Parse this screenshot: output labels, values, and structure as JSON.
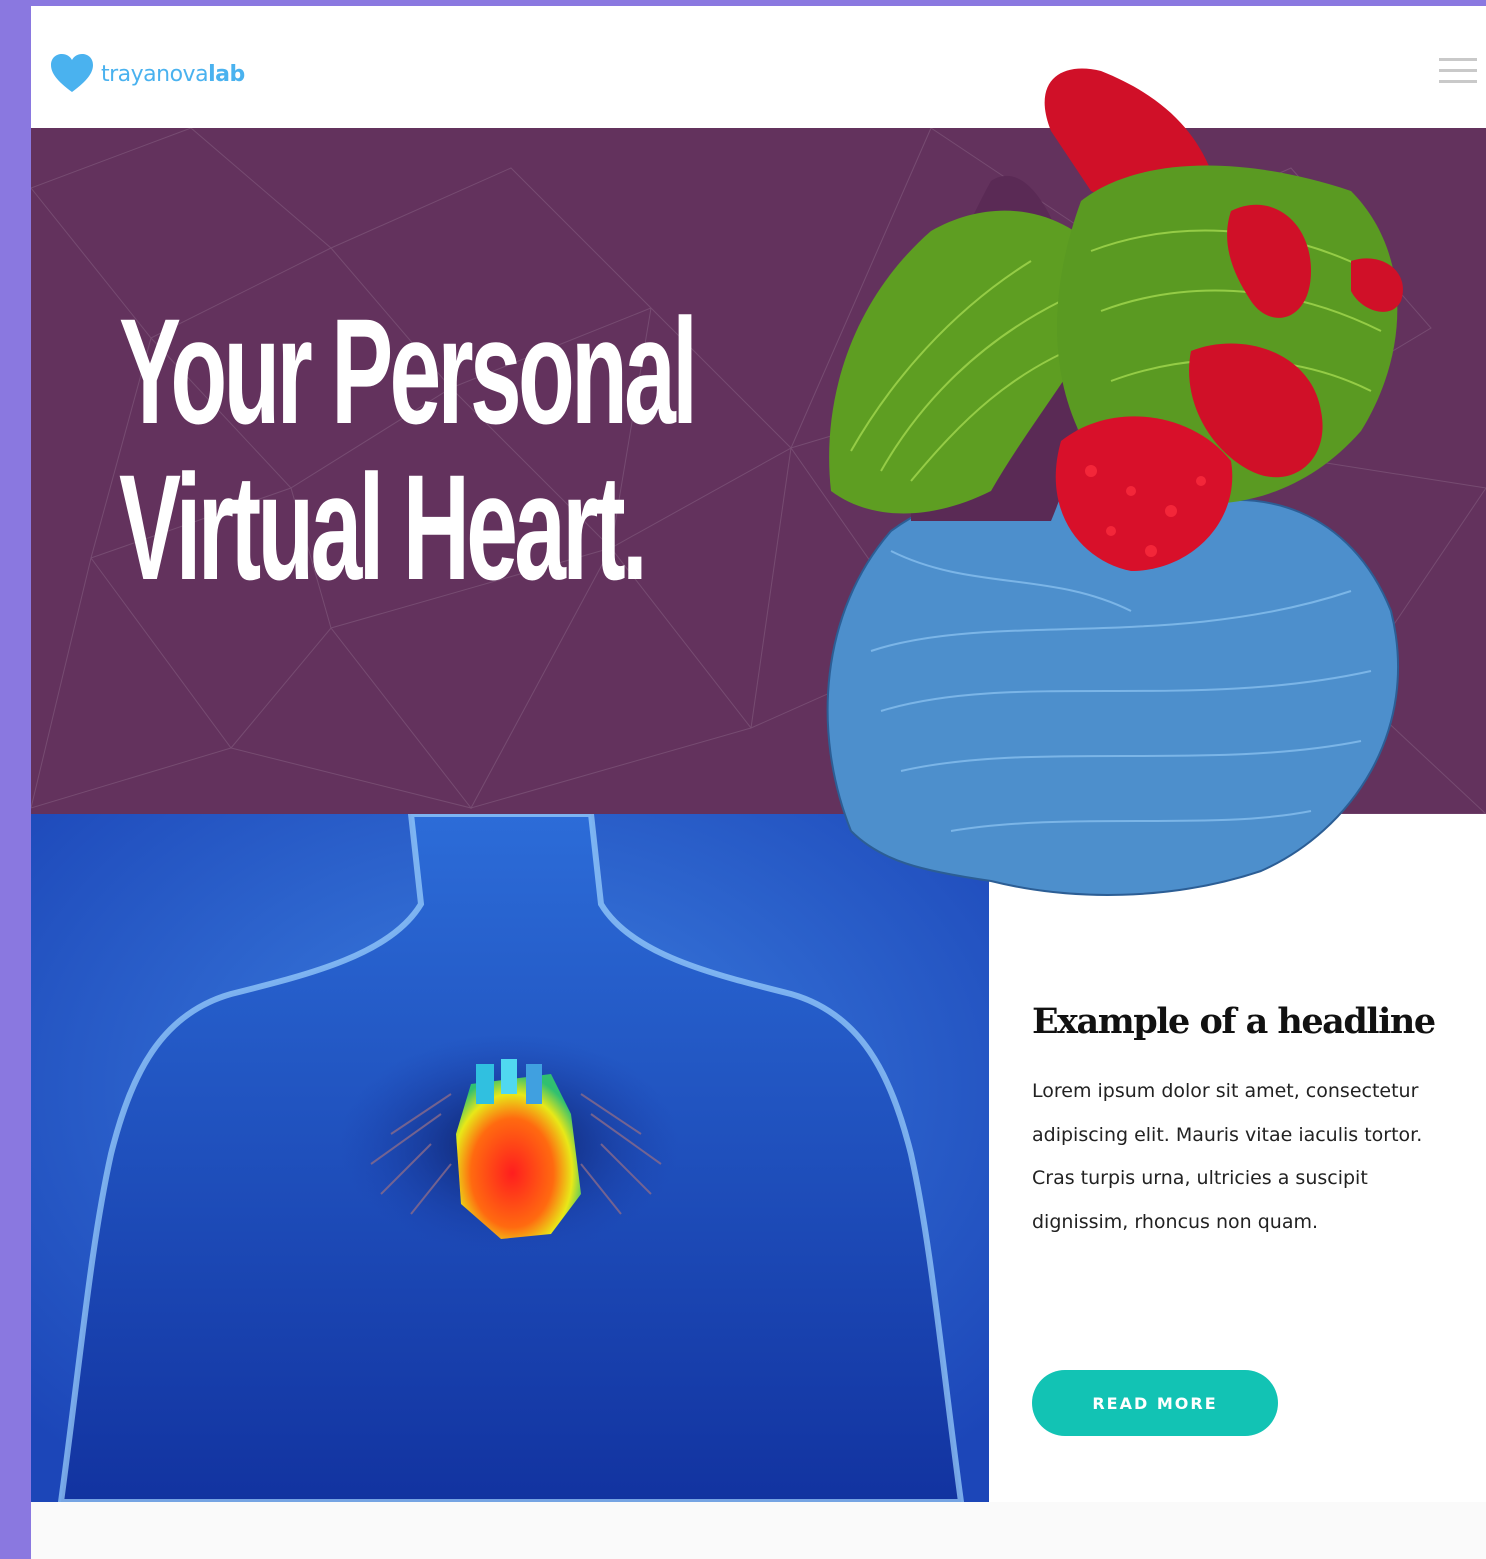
{
  "header": {
    "logo_prefix": "trayanova",
    "logo_suffix": "lab",
    "menu_icon": "hamburger-menu-icon"
  },
  "hero": {
    "title_line1": "Your Personal",
    "title_line2": "Virtual Heart."
  },
  "article": {
    "headline": "Example of a headline",
    "body": "Lorem ipsum dolor sit amet, consectetur adipiscing elit. Mauris vitae iaculis tortor. Cras turpis urna, ultricies a suscipit dignissim, rhoncus non quam.",
    "cta_label": "READ MORE"
  },
  "colors": {
    "page_background": "#8a78e0",
    "hero_background": "#63325d",
    "logo_blue": "#4ab2ef",
    "cta_teal": "#12c3b4",
    "body_image_blue": "#1f4fc8"
  }
}
